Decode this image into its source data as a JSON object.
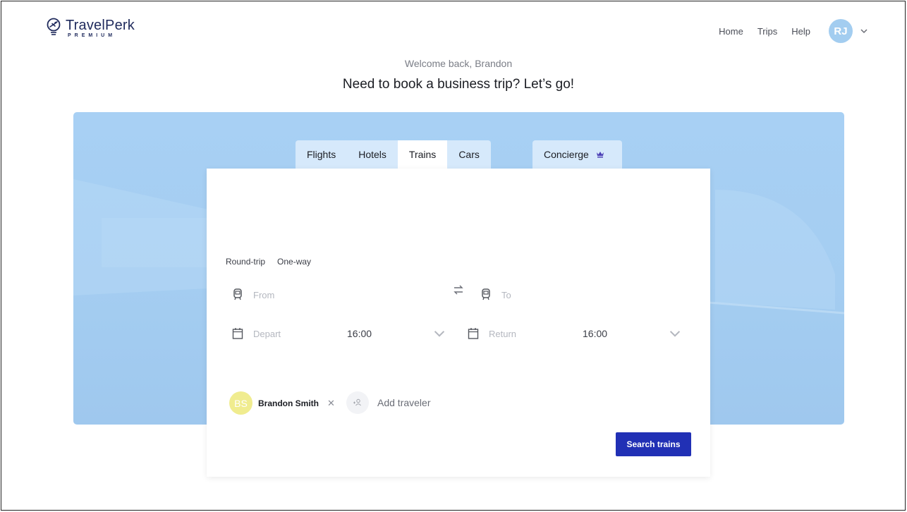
{
  "brand": {
    "name": "TravelPerk",
    "tier": "PREMIUM"
  },
  "nav": {
    "links": [
      "Home",
      "Trips",
      "Help"
    ],
    "user_initials": "RJ"
  },
  "hero": {
    "welcome": "Welcome back, Brandon",
    "headline": "Need to book a business trip? Let’s go!"
  },
  "tabs": [
    {
      "label": "Flights",
      "active": false
    },
    {
      "label": "Hotels",
      "active": false
    },
    {
      "label": "Trains",
      "active": true
    },
    {
      "label": "Cars",
      "active": false
    }
  ],
  "concierge": {
    "label": "Concierge",
    "icon": "crown-icon"
  },
  "form": {
    "trip_types": [
      "Round-trip",
      "One-way"
    ],
    "from_placeholder": "From",
    "to_placeholder": "To",
    "depart_placeholder": "Depart",
    "depart_time": "16:00",
    "return_placeholder": "Return",
    "return_time": "16:00"
  },
  "travelers": [
    {
      "initials": "BS",
      "name": "Brandon Smith"
    }
  ],
  "add_traveler_label": "Add traveler",
  "search_button": "Search trains",
  "colors": {
    "primary": "#2130b5",
    "hero": "#a6cef2",
    "avatar": "#a3cdf0",
    "traveler_avatar": "#f0ec8f"
  }
}
